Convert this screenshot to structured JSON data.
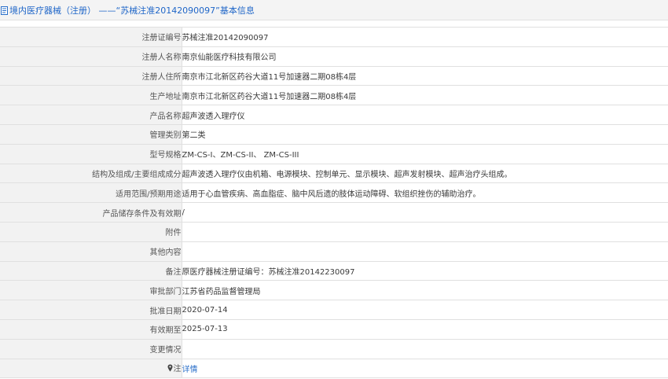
{
  "header": {
    "title": "境内医疗器械（注册） ——“苏械注准20142090097”基本信息",
    "icon": "document-icon"
  },
  "rows": [
    {
      "label": "注册证编号",
      "value": "苏械注准20142090097"
    },
    {
      "label": "注册人名称",
      "value": "南京仙能医疗科技有限公司"
    },
    {
      "label": "注册人住所",
      "value": "南京市江北新区药谷大道11号加速器二期08栋4层"
    },
    {
      "label": "生产地址",
      "value": "南京市江北新区药谷大道11号加速器二期08栋4层"
    },
    {
      "label": "产品名称",
      "value": "超声波透入理疗仪"
    },
    {
      "label": "管理类别",
      "value": "第二类"
    },
    {
      "label": "型号规格",
      "value": "ZM-CS-I、ZM-CS-II、 ZM-CS-III"
    },
    {
      "label": "结构及组成/主要组成成分",
      "value": "超声波透入理疗仪由机箱、电源模块、控制单元、显示模块、超声发射模块、超声治疗头组成。"
    },
    {
      "label": "适用范围/预期用途",
      "value": "适用于心血管疾病、高血脂症、脑中风后遗的肢体运动障碍、软组织挫伤的辅助治疗。"
    },
    {
      "label": "产品储存条件及有效期",
      "value": "/"
    },
    {
      "label": "附件",
      "value": ""
    },
    {
      "label": "其他内容",
      "value": ""
    },
    {
      "label": "备注",
      "value": "原医疗器械注册证编号：苏械注准20142230097"
    },
    {
      "label": "审批部门",
      "value": "江苏省药品监督管理局"
    },
    {
      "label": "批准日期",
      "value": "2020-07-14"
    },
    {
      "label": "有效期至",
      "value": "2025-07-13"
    },
    {
      "label": "变更情况",
      "value": ""
    }
  ],
  "note": {
    "label": "注",
    "icon": "map-pin-icon",
    "link": "详情"
  }
}
